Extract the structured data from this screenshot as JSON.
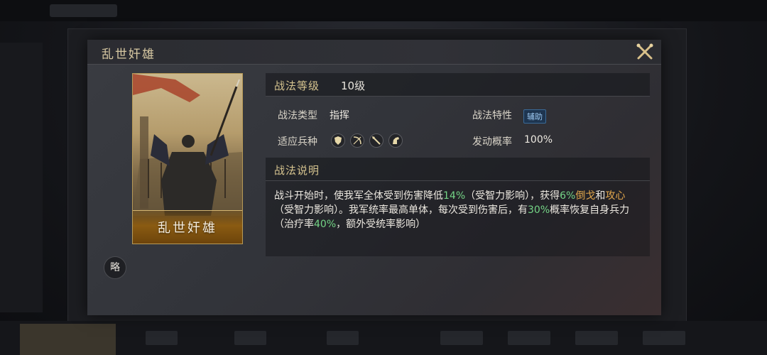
{
  "dialog": {
    "title": "乱世奸雄",
    "card_name": "乱世奸雄",
    "badge": "略"
  },
  "tactic": {
    "level_label": "战法等级",
    "level_value": "10级",
    "type_label": "战法类型",
    "type_value": "指挥",
    "trait_label": "战法特性",
    "trait_value": "辅助",
    "troops_label": "适应兵种",
    "troops_icons": [
      "shield-icon",
      "bow-icon",
      "spear-icon",
      "horse-icon"
    ],
    "trigger_label": "发动概率",
    "trigger_value": "100%",
    "desc_label": "战法说明",
    "desc": {
      "p1": "战斗开始时，使我军全体受到伤害降低",
      "v1": "14%",
      "p2": "（受智力影响），获得",
      "v2": "6%",
      "k1": "倒戈",
      "p3": "和",
      "k2": "攻心",
      "p4": "（受智力影响）。我军统率最高单体，每次受到伤害后，有",
      "v3": "30%",
      "p5": "概率恢复自身兵力（治疗率",
      "v4": "40%",
      "p6": "，额外受统率影响）"
    }
  },
  "colors": {
    "gold_label": "#d6c48f",
    "highlight_green": "#74d486",
    "highlight_orange": "#e2a74c",
    "tag_blue": "#1e3550"
  }
}
